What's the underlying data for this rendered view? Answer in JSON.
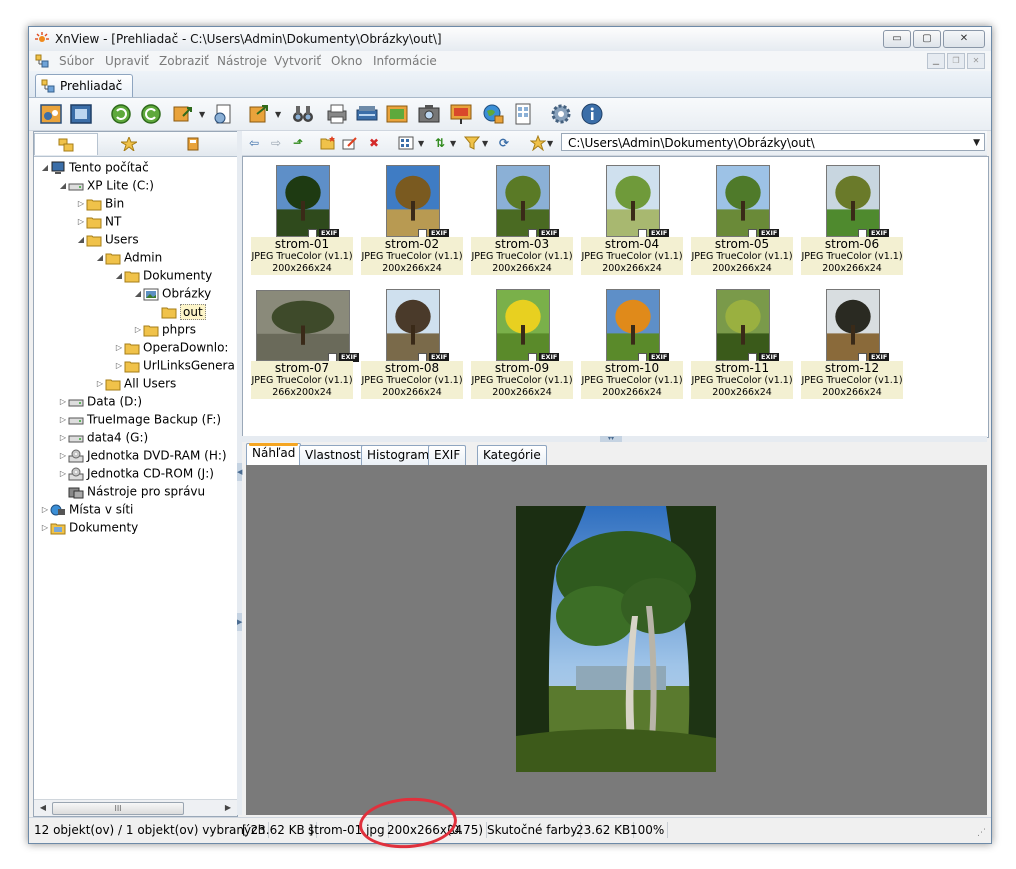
{
  "window": {
    "title": "XnView - [Prehliadač - C:\\Users\\Admin\\Dokumenty\\Obrázky\\out\\]",
    "controls": {
      "minimize": "▭",
      "maximize": "▢",
      "close": "✕"
    }
  },
  "menu": {
    "items": [
      "Súbor",
      "Upraviť",
      "Zobraziť",
      "Nástroje",
      "Vytvoriť",
      "Okno",
      "Informácie"
    ]
  },
  "tab": {
    "label": "Prehliadač"
  },
  "tree": {
    "nodes": [
      {
        "label": "Tento počítač"
      },
      {
        "label": "XP Lite (C:)"
      },
      {
        "label": "Bin"
      },
      {
        "label": "NT"
      },
      {
        "label": "Users"
      },
      {
        "label": "Admin"
      },
      {
        "label": "Dokumenty"
      },
      {
        "label": "Obrázky"
      },
      {
        "label": "out"
      },
      {
        "label": "phprs"
      },
      {
        "label": "OperaDownlo:"
      },
      {
        "label": "UrlLinksGenera"
      },
      {
        "label": "All Users"
      },
      {
        "label": "Data (D:)"
      },
      {
        "label": "TrueImage Backup (F:)"
      },
      {
        "label": "data4 (G:)"
      },
      {
        "label": "Jednotka DVD-RAM (H:)"
      },
      {
        "label": "Jednotka CD-ROM (J:)"
      },
      {
        "label": "Nástroje pro správu"
      },
      {
        "label": "Místa v síti"
      },
      {
        "label": "Dokumenty"
      }
    ]
  },
  "path": {
    "value": "C:\\Users\\Admin\\Dokumenty\\Obrázky\\out\\"
  },
  "thumbnails": {
    "badge": "EXIF",
    "items": [
      {
        "name": "strom-01",
        "format": "JPEG TrueColor (v1.1)",
        "dims": "200x266x24"
      },
      {
        "name": "strom-02",
        "format": "JPEG TrueColor (v1.1)",
        "dims": "200x266x24"
      },
      {
        "name": "strom-03",
        "format": "JPEG TrueColor (v1.1)",
        "dims": "200x266x24"
      },
      {
        "name": "strom-04",
        "format": "JPEG TrueColor (v1.1)",
        "dims": "200x266x24"
      },
      {
        "name": "strom-05",
        "format": "JPEG TrueColor (v1.1)",
        "dims": "200x266x24"
      },
      {
        "name": "strom-06",
        "format": "JPEG TrueColor (v1.1)",
        "dims": "200x266x24"
      },
      {
        "name": "strom-07",
        "format": "JPEG TrueColor (v1.1)",
        "dims": "266x200x24"
      },
      {
        "name": "strom-08",
        "format": "JPEG TrueColor (v1.1)",
        "dims": "200x266x24"
      },
      {
        "name": "strom-09",
        "format": "JPEG TrueColor (v1.1)",
        "dims": "200x266x24"
      },
      {
        "name": "strom-10",
        "format": "JPEG TrueColor (v1.1)",
        "dims": "200x266x24"
      },
      {
        "name": "strom-11",
        "format": "JPEG TrueColor (v1.1)",
        "dims": "200x266x24"
      },
      {
        "name": "strom-12",
        "format": "JPEG TrueColor (v1.1)",
        "dims": "200x266x24"
      }
    ]
  },
  "preview_tabs": [
    "Náhľad",
    "Vlastnosti",
    "Histogram",
    "EXIF",
    "Kategórie"
  ],
  "status": {
    "objects": "12 objekt(ov) / 1 objekt(ov) vybraných",
    "size": "[ 23.62 KB ]",
    "filename": "strom-01.jpg",
    "dims": "200x266x24",
    "ratio": "(0.75)",
    "colors": "Skutočné farby",
    "filesize": "23.62 KB",
    "zoom": "100%"
  },
  "colors": {
    "caption_bg": "#f3f0d2",
    "annotation": "#e0303c",
    "preview_bg": "#7a7a7a"
  }
}
